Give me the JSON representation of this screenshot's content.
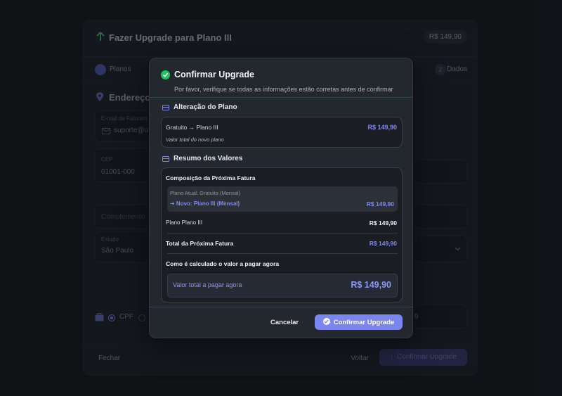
{
  "background": {
    "title": "Fazer Upgrade para Plano III",
    "price_badge": "R$ 149,90",
    "steps": {
      "step1_label": "Planos",
      "step2_number": "2",
      "step2_label": "Dados"
    },
    "section_title": "Endereço d",
    "fields": {
      "email_label": "E-mail de Faturam",
      "email_value": "suporte@u",
      "cep_label": "CEP",
      "cep_value": "01001-000",
      "complemento_placeholder": "Complemento",
      "estado_label": "Estado",
      "estado_value": "São Paulo",
      "cpf_label": "CPF",
      "doc_suffix": "9"
    },
    "footer": {
      "close_label": "Fechar",
      "back_label": "Voltar",
      "confirm_label": "Confirmar Upgrade"
    }
  },
  "modal": {
    "title": "Confirmar Upgrade",
    "subtitle": "Por favor, verifique se todas as informações estão corretas antes de confirmar",
    "plan_change": {
      "heading": "Alteração do Plano",
      "transition": "Gratuito → Plano III",
      "price": "R$ 149,90",
      "note": "Valor total do novo plano"
    },
    "summary": {
      "heading": "Resumo dos Valores",
      "composition_title": "Composição da Próxima Fatura",
      "current_plan": "Plano Atual: Gratuito (Mensal)",
      "new_plan": "➜ Novo: Plano III (Mensal)",
      "new_plan_price": "R$ 149,90",
      "line_label": "Plano Plano III",
      "line_price": "R$ 149,90",
      "total_label": "Total da Próxima Fatura",
      "total_price": "R$ 149,90",
      "calc_title": "Como é calculado o valor a pagar agora",
      "pay_now_label": "Valor total a pagar agora",
      "pay_now_value": "R$ 149,90"
    },
    "actions": {
      "cancel_label": "Cancelar",
      "confirm_label": "Confirmar Upgrade"
    }
  },
  "colors": {
    "accent": "#7b85ef",
    "success": "#22c35e",
    "surface": "#23272e",
    "background": "#15181d"
  }
}
